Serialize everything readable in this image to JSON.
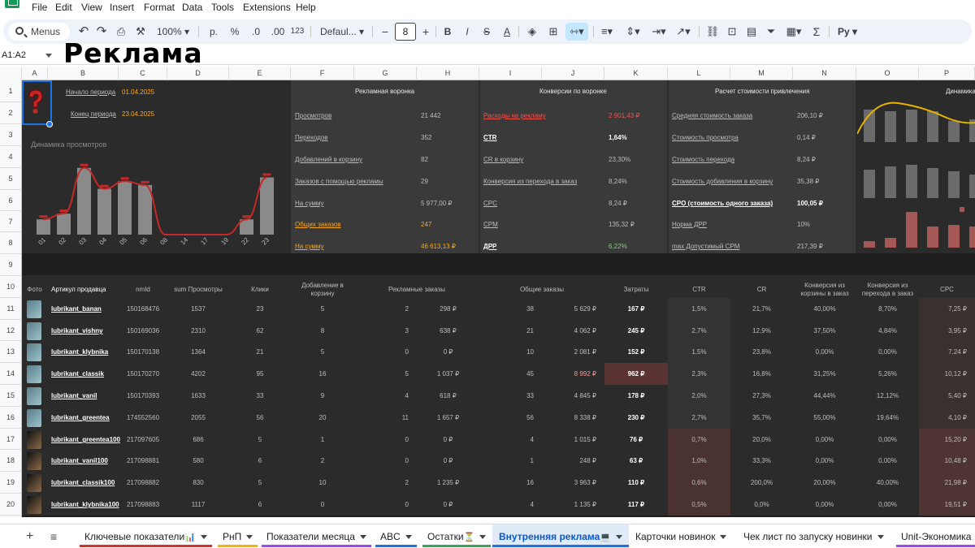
{
  "menu": [
    "File",
    "Edit",
    "View",
    "Insert",
    "Format",
    "Data",
    "Tools",
    "Extensions",
    "Help"
  ],
  "toolbar": {
    "search_label": "Menus",
    "zoom": "100%",
    "currency": "р.",
    "percent": "%",
    "dec_decrease": ".0",
    "dec_increase": ".00",
    "number_format": "123",
    "font": "Defaul...",
    "font_size": "8",
    "minus": "−",
    "plus": "+",
    "bold": "B",
    "italic": "I",
    "strike": "S",
    "text_color": "A",
    "sum": "Σ",
    "input_tool": "Pу"
  },
  "name_box": "A1:A2",
  "overlay_title": "Реклама",
  "columns": [
    "A",
    "B",
    "C",
    "D",
    "E",
    "F",
    "G",
    "H",
    "I",
    "J",
    "K",
    "L",
    "M",
    "N",
    "O",
    "P"
  ],
  "rows": [
    "1",
    "2",
    "3",
    "4",
    "5",
    "6",
    "7",
    "8",
    "9",
    "10",
    "11",
    "12",
    "13",
    "14",
    "15",
    "16",
    "17",
    "18",
    "19",
    "20"
  ],
  "period": {
    "start_label": "Начало периода",
    "start_value": "01.04.2025",
    "end_label": "Конец периода",
    "end_value": "23.04.2025"
  },
  "views_chart": {
    "title": "Динамика просмотров",
    "days": [
      "01",
      "02",
      "03",
      "04",
      "05",
      "06",
      "08",
      "14",
      "17",
      "19",
      "22",
      "23"
    ]
  },
  "chart_data": [
    {
      "type": "bar",
      "title": "Динамика просмотров",
      "categories": [
        "01",
        "02",
        "03",
        "04",
        "05",
        "06",
        "08",
        "14",
        "17",
        "19",
        "22",
        "23"
      ],
      "values": [
        40,
        55,
        175,
        120,
        140,
        130,
        0,
        0,
        0,
        0,
        40,
        150
      ],
      "ylim": [
        0,
        200
      ]
    }
  ],
  "funnel": {
    "header": "Рекламная воронка",
    "rows": [
      {
        "label": "Просмотров",
        "value": "21 442"
      },
      {
        "label": "Переходов",
        "value": "352"
      },
      {
        "label": "Добавлений в корзину",
        "value": "82"
      },
      {
        "label": "Заказов с помощью рекламы",
        "value": "29"
      },
      {
        "label": "На сумму",
        "value": "5 977,00 ₽"
      },
      {
        "label": "Общих заказов",
        "value": "247"
      },
      {
        "label": "На сумму",
        "value": "46 613,13 ₽"
      }
    ]
  },
  "conversions": {
    "header": "Конверсии по воронке",
    "rows": [
      {
        "label": "Расходы на рекламу",
        "value": "2 901,43 ₽"
      },
      {
        "label": "CTR",
        "value": "1,64%"
      },
      {
        "label": "CR в корзину",
        "value": "23,30%"
      },
      {
        "label": "Конверсия из перехода в заказ",
        "value": "8,24%"
      },
      {
        "label": "CPC",
        "value": "8,24 ₽"
      },
      {
        "label": "CPM",
        "value": "135,32 ₽"
      },
      {
        "label": "ДРР",
        "value": "6,22%"
      }
    ]
  },
  "acquisition": {
    "header": "Расчет стоимости привлечения",
    "rows": [
      {
        "label": "Средняя стоимость заказа",
        "value": "206,10 ₽"
      },
      {
        "label": "Стоимость просмотра",
        "value": "0,14 ₽"
      },
      {
        "label": "Стоимость перехода",
        "value": "8,24 ₽"
      },
      {
        "label": "Стоимость добавления в корзину",
        "value": "35,38 ₽"
      },
      {
        "label": "CPO (стоимость одного заказа)",
        "value": "100,05 ₽"
      },
      {
        "label": "Норма ДРР",
        "value": "10%"
      },
      {
        "label": "max Допустимый CPM",
        "value": "217,39 ₽"
      }
    ]
  },
  "dynamics": {
    "header": "Динамика"
  },
  "table": {
    "headers": [
      "Фото",
      "Артикул продавца",
      "nmId",
      "sum Просмотры",
      "Клики",
      "Добавление в корзину",
      "Рекламные заказы",
      "Общие заказы",
      "Затраты",
      "CTR",
      "CR",
      "Конверсия из корзины в заказ",
      "Конверсия из перехода в заказ",
      "CPC"
    ],
    "rows": [
      [
        "lubrikant_banan",
        "150168476",
        "1537",
        "23",
        "5",
        "2",
        "298 ₽",
        "38",
        "5 629 ₽",
        "167 ₽",
        "1,5%",
        "21,7%",
        "40,00%",
        "8,70%",
        "7,25 ₽"
      ],
      [
        "lubrikant_vishny",
        "150169036",
        "2310",
        "62",
        "8",
        "3",
        "638 ₽",
        "21",
        "4 062 ₽",
        "245 ₽",
        "2,7%",
        "12,9%",
        "37,50%",
        "4,84%",
        "3,95 ₽"
      ],
      [
        "lubrikant_klybnika",
        "150170138",
        "1364",
        "21",
        "5",
        "0",
        "0 ₽",
        "10",
        "2 081 ₽",
        "152 ₽",
        "1,5%",
        "23,8%",
        "0,00%",
        "0,00%",
        "7,24 ₽"
      ],
      [
        "lubrikant_classik",
        "150170270",
        "4202",
        "95",
        "16",
        "5",
        "1 037 ₽",
        "45",
        "8 992 ₽",
        "962 ₽",
        "2,3%",
        "16,8%",
        "31,25%",
        "5,26%",
        "10,12 ₽"
      ],
      [
        "lubrikant_vanil",
        "150170393",
        "1633",
        "33",
        "9",
        "4",
        "618 ₽",
        "33",
        "4 845 ₽",
        "178 ₽",
        "2,0%",
        "27,3%",
        "44,44%",
        "12,12%",
        "5,40 ₽"
      ],
      [
        "lubrikant_greentea",
        "174552560",
        "2055",
        "56",
        "20",
        "11",
        "1 657 ₽",
        "56",
        "8 338 ₽",
        "230 ₽",
        "2,7%",
        "35,7%",
        "55,00%",
        "19,64%",
        "4,10 ₽"
      ],
      [
        "lubrikant_greentea100",
        "217097605",
        "686",
        "5",
        "1",
        "0",
        "0 ₽",
        "4",
        "1 015 ₽",
        "76 ₽",
        "0,7%",
        "20,0%",
        "0,00%",
        "0,00%",
        "15,20 ₽"
      ],
      [
        "lubrikant_vanil100",
        "217098881",
        "580",
        "6",
        "2",
        "0",
        "0 ₽",
        "1",
        "248 ₽",
        "63 ₽",
        "1,0%",
        "33,3%",
        "0,00%",
        "0,00%",
        "10,48 ₽"
      ],
      [
        "lubrikant_classik100",
        "217098882",
        "830",
        "5",
        "10",
        "2",
        "1 235 ₽",
        "16",
        "3 963 ₽",
        "110 ₽",
        "0,6%",
        "200,0%",
        "20,00%",
        "40,00%",
        "21,98 ₽"
      ],
      [
        "lubrikant_klybnika100",
        "217098883",
        "1117",
        "6",
        "0",
        "0",
        "0 ₽",
        "4",
        "1 135 ₽",
        "117 ₽",
        "0,5%",
        "0,0%",
        "0,00%",
        "0,00%",
        "19,51 ₽"
      ]
    ]
  },
  "tabs": [
    {
      "label": "Ключевые показатели",
      "icon": "📊",
      "color": "#d93025"
    },
    {
      "label": "РнП",
      "icon": "",
      "color": "#f4b400"
    },
    {
      "label": "Показатели месяца",
      "icon": "",
      "color": "#a142f4"
    },
    {
      "label": "ABC",
      "icon": "",
      "color": "#1a73e8"
    },
    {
      "label": "Остатки",
      "icon": "⏳",
      "color": "#34a853"
    },
    {
      "label": "Внутренняя реклама",
      "icon": "💻",
      "color": "#1a73e8",
      "active": true
    },
    {
      "label": "Карточки новинок",
      "icon": "",
      "color": ""
    },
    {
      "label": "Чек лист по запуску новинки",
      "icon": "",
      "color": ""
    },
    {
      "label": "Unit-Экономика",
      "icon": "",
      "color": "#a142f4"
    }
  ]
}
